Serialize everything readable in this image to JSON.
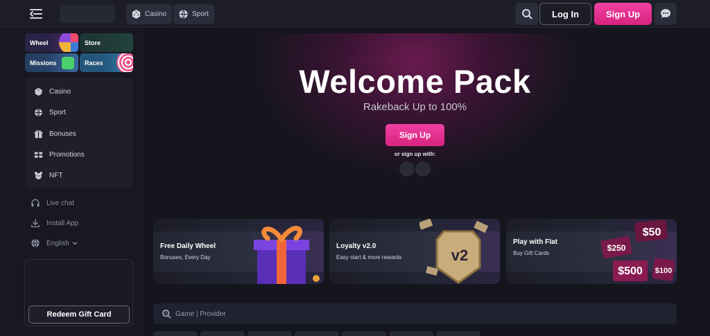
{
  "header": {
    "tabs": [
      {
        "label": "Casino",
        "icon": "dice-icon"
      },
      {
        "label": "Sport",
        "icon": "ball-icon"
      }
    ],
    "login_label": "Log In",
    "signup_label": "Sign Up"
  },
  "sidebar": {
    "quick_links": [
      "Wheel",
      "Store",
      "Missions",
      "Races"
    ],
    "nav": [
      {
        "label": "Casino",
        "icon": "dice-icon"
      },
      {
        "label": "Sport",
        "icon": "ball-icon"
      },
      {
        "label": "Bonuses",
        "icon": "gift-icon"
      },
      {
        "label": "Promotions",
        "icon": "promotions-icon"
      },
      {
        "label": "NFT",
        "icon": "nft-icon"
      }
    ],
    "misc": [
      {
        "label": "Live chat",
        "icon": "headset-icon"
      },
      {
        "label": "Install App",
        "icon": "download-icon"
      },
      {
        "label": "English",
        "icon": "globe-icon"
      }
    ],
    "redeem_label": "Redeem Gift Card"
  },
  "hero": {
    "title": "Welcome Pack",
    "subtitle": "Rakeback Up to 100%",
    "signup_label": "Sign Up",
    "or_text": "or sign up with:"
  },
  "promos": [
    {
      "title": "Free Daily Wheel",
      "desc": "Bonuses, Every Day"
    },
    {
      "title": "Loyalty v2.0",
      "desc": "Easy start & more rewards"
    },
    {
      "title": "Play with Flat",
      "desc": "Buy Gift Cards"
    }
  ],
  "search": {
    "placeholder": "Game | Provider"
  },
  "colors": {
    "accent": "#e8318f",
    "background": "#14151d",
    "panel": "#1e1f2a"
  }
}
